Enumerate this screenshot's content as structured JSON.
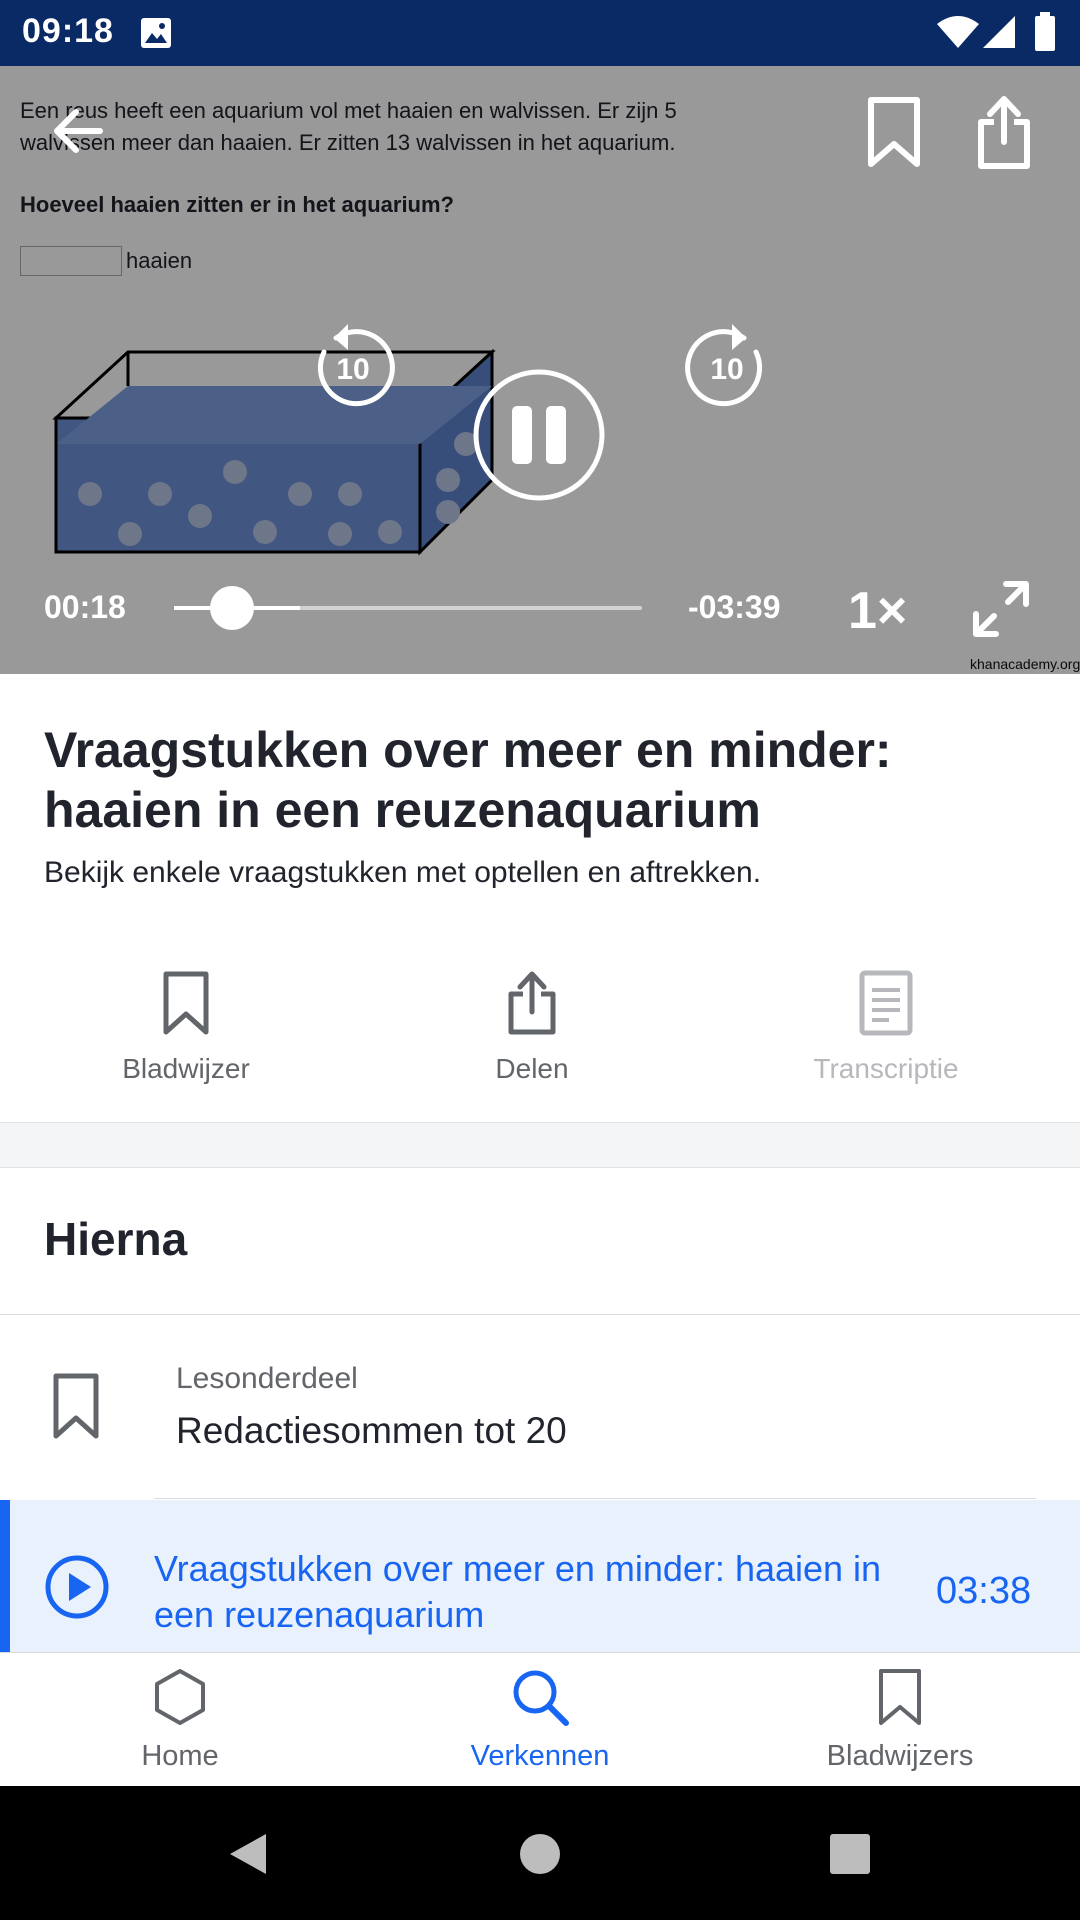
{
  "status_bar": {
    "time": "09:18"
  },
  "video": {
    "question": {
      "line1": "Een reus heeft een aquarium vol met haaien en walvissen. Er zijn 5",
      "line2": "walvissen meer dan haaien. Er zitten 13 walvissen in het aquarium.",
      "prompt": "Hoeveel haaien zitten er in het aquarium?",
      "unit": "haaien"
    },
    "watermark": "khanacademy.org",
    "rewind_label": "10",
    "forward_label": "10",
    "time_current": "00:18",
    "time_remaining": "-03:39",
    "speed": "1×",
    "progress": 0.076,
    "buffered": 0.27
  },
  "info": {
    "title": "Vraagstukken over meer en minder: haaien in een reuzenaquarium",
    "description": "Bekijk enkele vraagstukken met optellen en aftrekken."
  },
  "actions": {
    "bookmark": "Bladwijzer",
    "share": "Delen",
    "transcript": "Transcriptie"
  },
  "next": {
    "heading": "Hierna",
    "unit_type": "Lesonderdeel",
    "unit_title": "Redactiesommen tot 20",
    "current_title": "Vraagstukken over meer en minder: haaien in een reuzenaquarium",
    "current_duration": "03:38"
  },
  "bottom_nav": {
    "home": "Home",
    "explore": "Verkennen",
    "bookmarks": "Bladwijzers"
  },
  "colors": {
    "accent": "#1865f2",
    "status_bar": "#0a2a66"
  }
}
